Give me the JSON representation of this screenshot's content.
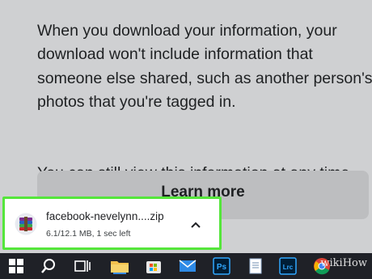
{
  "panel": {
    "paragraph_1": "When you download your information, your download won't include information that someone else shared, such as another person's photos that you're tagged in.",
    "paragraph_2": "You can still view this information at any time.",
    "learn_more_label": "Learn more"
  },
  "download": {
    "file_name": "facebook-nevelynn....zip",
    "status": "6.1/12.1 MB, 1 sec left",
    "file_icon": "winrar-archive-icon",
    "expand_icon": "chevron-up-icon"
  },
  "taskbar": {
    "items": [
      {
        "name": "start-icon"
      },
      {
        "name": "search-icon"
      },
      {
        "name": "task-view-icon"
      },
      {
        "name": "file-explorer-icon"
      },
      {
        "name": "microsoft-store-icon"
      },
      {
        "name": "mail-icon"
      },
      {
        "name": "photoshop-icon",
        "label": "Ps"
      },
      {
        "name": "notepad-icon"
      },
      {
        "name": "lightroom-icon",
        "label": "Lrc"
      },
      {
        "name": "chrome-icon"
      }
    ],
    "watermark": "wikiHow"
  },
  "colors": {
    "highlight": "#55e63b",
    "taskbar": "#1f2127",
    "panel_bg": "#cfd0d2"
  }
}
